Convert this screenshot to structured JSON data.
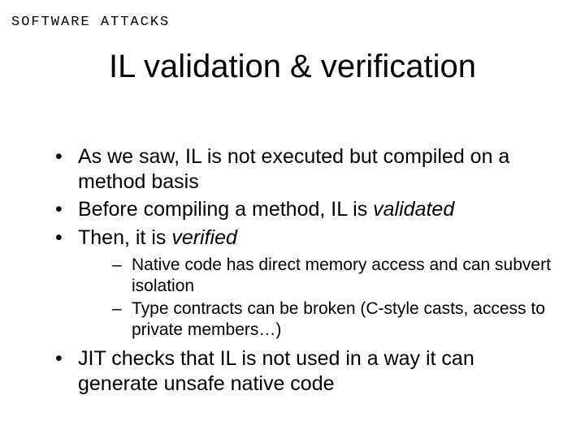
{
  "header": {
    "label": "SOFTWARE ATTACKS"
  },
  "title": "IL validation & verification",
  "bullets": [
    {
      "pre": "As we saw, IL is not executed but compiled on a method basis",
      "em": "",
      "post": ""
    },
    {
      "pre": "Before compiling a method, IL is ",
      "em": "validated",
      "post": ""
    },
    {
      "pre": "Then, it is ",
      "em": "verified",
      "post": "",
      "sub": [
        "Native code has direct memory access and can subvert isolation",
        "Type contracts can be broken (C-style casts, access to private members…)"
      ]
    },
    {
      "pre": "JIT checks that IL is not used in a way it can generate unsafe native code",
      "em": "",
      "post": ""
    }
  ]
}
